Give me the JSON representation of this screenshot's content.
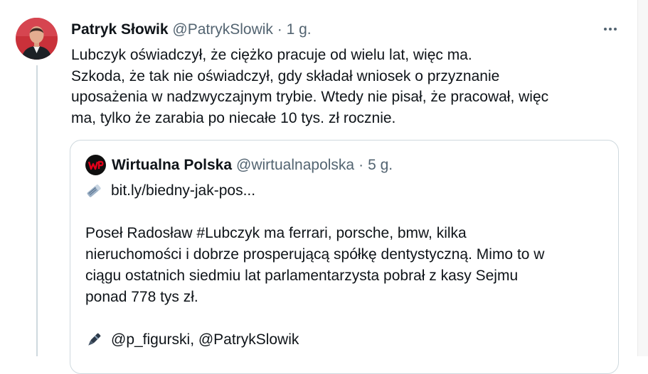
{
  "tweet": {
    "author_name": "Patryk Słowik",
    "author_handle": "@PatrykSlowik",
    "separator": "·",
    "time": "1 g.",
    "lines": [
      "Lubczyk oświadczył, że ciężko pracuje od wielu lat, więc ma.",
      "Szkoda, że tak nie oświadczył, gdy składał wniosek o przyznanie",
      "uposażenia w nadzwyczajnym trybie. Wtedy nie pisał, że pracował, więc",
      "ma, tylko że zarabia po niecałe 10 tys. zł rocznie."
    ],
    "more_icon": "more-horizontal-icon"
  },
  "quote": {
    "author_name": "Wirtualna Polska",
    "author_handle": "@wirtualnapolska",
    "separator": "·",
    "time": "5 g.",
    "logo_text": "WP",
    "link_icon": "newspaper-icon",
    "link_text": "bit.ly/biedny-jak-pos...",
    "body_lines": [
      "Poseł Radosław #Lubczyk ma ferrari, porsche, bmw, kilka",
      "nieruchomości i dobrze prosperującą spółkę dentystyczną. Mimo to w",
      "ciągu ostatnich siedmiu lat parlamentarzysta pobrał z kasy Sejmu",
      "ponad 778 tys zł."
    ],
    "credit_icon": "pen-icon",
    "credit_text": "@p_figurski, @PatrykSlowik"
  },
  "colors": {
    "text": "#0f1419",
    "muted": "#536471",
    "border": "#cfd9de",
    "wp_red": "#e2001a"
  }
}
